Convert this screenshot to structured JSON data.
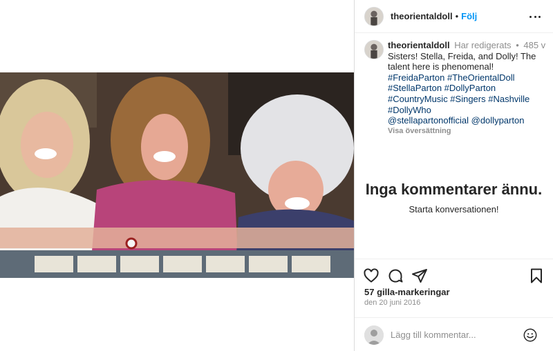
{
  "post": {
    "username": "theorientaldoll",
    "follow_label": "Följ",
    "separator": "•"
  },
  "caption": {
    "username": "theorientaldoll",
    "edited": "Har redigerats",
    "edited_sep": "•",
    "time_ago": "485 v",
    "text_lines": [
      "Sisters! Stella, Freida, and Dolly! The",
      "talent here is phenomenal!"
    ],
    "hashtag_lines": [
      "#FreidaParton #TheOrientalDoll",
      "#StellaParton #DollyParton",
      "#CountryMusic #Singers #Nashville",
      "#DollyWho",
      "@stellapartonofficial @dollyparton"
    ],
    "translate_label": "Visa översättning"
  },
  "comments": {
    "empty_title": "Inga kommentarer ännu.",
    "empty_subtitle": "Starta konversationen!"
  },
  "stats": {
    "likes": "57 gilla-markeringar",
    "date": "den 20 juni 2016"
  },
  "comment_box": {
    "placeholder": "Lägg till kommentar..."
  },
  "icons": {
    "more": "more-options-icon",
    "like": "heart-icon",
    "comment": "comment-icon",
    "share": "send-icon",
    "save": "bookmark-icon",
    "emoji": "emoji-icon"
  },
  "colors": {
    "link_blue": "#0095f6",
    "hashtag": "#00376b",
    "muted": "#8e8e8e",
    "text": "#262626"
  }
}
